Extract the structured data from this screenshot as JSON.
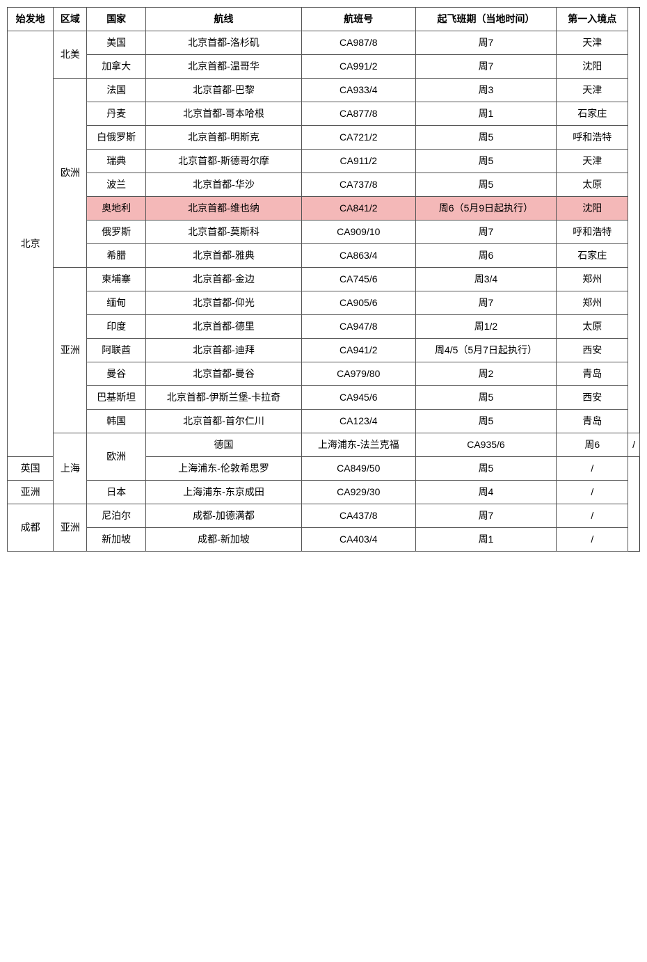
{
  "headers": [
    "始发地",
    "区域",
    "国家",
    "航线",
    "航班号",
    "起飞班期（当地时间）",
    "第一入境点"
  ],
  "rows": [
    {
      "origin": "北京",
      "origin_rowspan": 18,
      "region": "北美",
      "region_rowspan": 2,
      "country": "美国",
      "route": "北京首都-洛杉矶",
      "flight": "CA987/8",
      "schedule": "周7",
      "entry": "天津",
      "highlight": false
    },
    {
      "origin": null,
      "region": null,
      "country": "加拿大",
      "route": "北京首都-温哥华",
      "flight": "CA991/2",
      "schedule": "周7",
      "entry": "沈阳",
      "highlight": false
    },
    {
      "origin": null,
      "region": "欧洲",
      "region_rowspan": 8,
      "country": "法国",
      "route": "北京首都-巴黎",
      "flight": "CA933/4",
      "schedule": "周3",
      "entry": "天津",
      "highlight": false
    },
    {
      "origin": null,
      "region": null,
      "country": "丹麦",
      "route": "北京首都-哥本哈根",
      "flight": "CA877/8",
      "schedule": "周1",
      "entry": "石家庄",
      "highlight": false
    },
    {
      "origin": null,
      "region": null,
      "country": "白俄罗斯",
      "route": "北京首都-明斯克",
      "flight": "CA721/2",
      "schedule": "周5",
      "entry": "呼和浩特",
      "highlight": false
    },
    {
      "origin": null,
      "region": null,
      "country": "瑞典",
      "route": "北京首都-斯德哥尔摩",
      "flight": "CA911/2",
      "schedule": "周5",
      "entry": "天津",
      "highlight": false
    },
    {
      "origin": null,
      "region": null,
      "country": "波兰",
      "route": "北京首都-华沙",
      "flight": "CA737/8",
      "schedule": "周5",
      "entry": "太原",
      "highlight": false
    },
    {
      "origin": null,
      "region": null,
      "country": "奥地利",
      "route": "北京首都-维也纳",
      "flight": "CA841/2",
      "schedule": "周6（5月9日起执行）",
      "entry": "沈阳",
      "highlight": true
    },
    {
      "origin": null,
      "region": null,
      "country": "俄罗斯",
      "route": "北京首都-莫斯科",
      "flight": "CA909/10",
      "schedule": "周7",
      "entry": "呼和浩特",
      "highlight": false
    },
    {
      "origin": null,
      "region": null,
      "country": "希腊",
      "route": "北京首都-雅典",
      "flight": "CA863/4",
      "schedule": "周6",
      "entry": "石家庄",
      "highlight": false
    },
    {
      "origin": null,
      "region": "亚洲",
      "region_rowspan": 7,
      "country": "柬埔寨",
      "route": "北京首都-金边",
      "flight": "CA745/6",
      "schedule": "周3/4",
      "entry": "郑州",
      "highlight": false
    },
    {
      "origin": null,
      "region": null,
      "country": "缅甸",
      "route": "北京首都-仰光",
      "flight": "CA905/6",
      "schedule": "周7",
      "entry": "郑州",
      "highlight": false
    },
    {
      "origin": null,
      "region": null,
      "country": "印度",
      "route": "北京首都-德里",
      "flight": "CA947/8",
      "schedule": "周1/2",
      "entry": "太原",
      "highlight": false
    },
    {
      "origin": null,
      "region": null,
      "country": "阿联酋",
      "route": "北京首都-迪拜",
      "flight": "CA941/2",
      "schedule": "周4/5（5月7日起执行）",
      "entry": "西安",
      "highlight": false
    },
    {
      "origin": null,
      "region": null,
      "country": "曼谷",
      "route": "北京首都-曼谷",
      "flight": "CA979/80",
      "schedule": "周2",
      "entry": "青岛",
      "highlight": false
    },
    {
      "origin": null,
      "region": null,
      "country": "巴基斯坦",
      "route": "北京首都-伊斯兰堡-卡拉奇",
      "flight": "CA945/6",
      "schedule": "周5",
      "entry": "西安",
      "highlight": false
    },
    {
      "origin": null,
      "region": null,
      "country": "韩国",
      "route": "北京首都-首尔仁川",
      "flight": "CA123/4",
      "schedule": "周5",
      "entry": "青岛",
      "highlight": false
    },
    {
      "origin": "上海",
      "origin_rowspan": 3,
      "region": "欧洲",
      "region_rowspan": 2,
      "country": "德国",
      "route": "上海浦东-法兰克福",
      "flight": "CA935/6",
      "schedule": "周6",
      "entry": "/",
      "highlight": false
    },
    {
      "origin": null,
      "region": null,
      "country": "英国",
      "route": "上海浦东-伦敦希思罗",
      "flight": "CA849/50",
      "schedule": "周5",
      "entry": "/",
      "highlight": false
    },
    {
      "origin": null,
      "region": "亚洲",
      "region_rowspan": 1,
      "country": "日本",
      "route": "上海浦东-东京成田",
      "flight": "CA929/30",
      "schedule": "周4",
      "entry": "/",
      "highlight": false
    },
    {
      "origin": "成都",
      "origin_rowspan": 2,
      "region": "亚洲",
      "region_rowspan": 2,
      "country": "尼泊尔",
      "route": "成都-加德满都",
      "flight": "CA437/8",
      "schedule": "周7",
      "entry": "/",
      "highlight": false
    },
    {
      "origin": null,
      "region": null,
      "country": "新加坡",
      "route": "成都-新加坡",
      "flight": "CA403/4",
      "schedule": "周1",
      "entry": "/",
      "highlight": false
    }
  ]
}
